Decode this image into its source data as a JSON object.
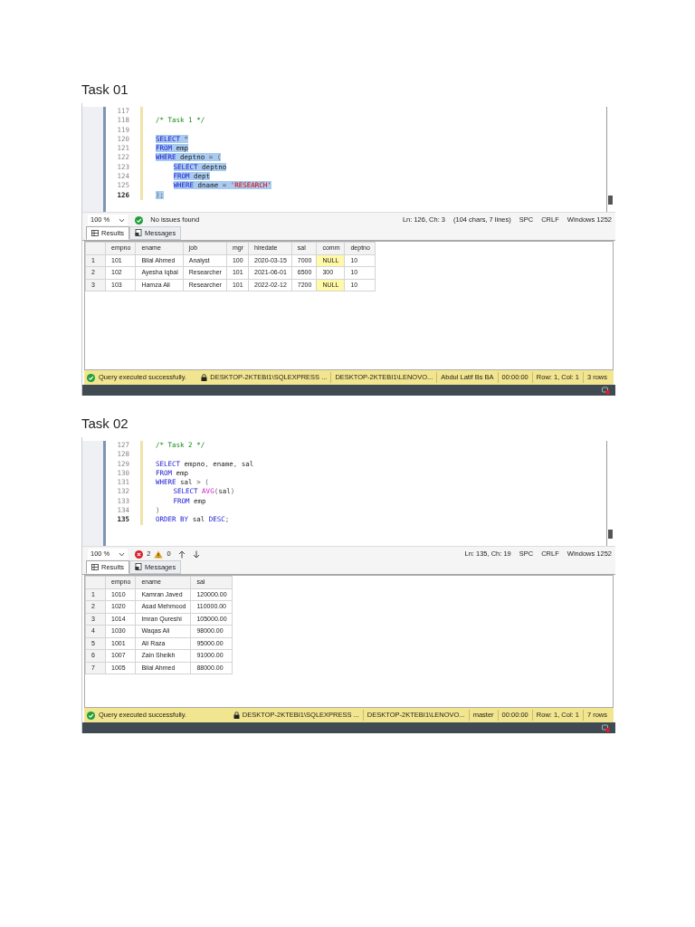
{
  "tasks": [
    {
      "heading": "Task 01",
      "editor": {
        "lines": [
          {
            "number": "117",
            "current": false,
            "selected": false
          },
          {
            "number": "118",
            "current": false,
            "selected": false,
            "indented": false,
            "tokens": [
              {
                "kind": "comment",
                "text": "/* Task 1 */"
              }
            ]
          },
          {
            "number": "119",
            "current": false,
            "selected": false
          },
          {
            "number": "120",
            "current": false,
            "selected": true,
            "indented": false,
            "tokens": [
              {
                "kind": "keyword",
                "text": "SELECT"
              },
              {
                "kind": "punct",
                "text": " *"
              }
            ]
          },
          {
            "number": "121",
            "current": false,
            "selected": true,
            "indented": false,
            "tokens": [
              {
                "kind": "keyword",
                "text": "FROM"
              },
              {
                "kind": "ident",
                "text": " emp"
              }
            ]
          },
          {
            "number": "122",
            "current": false,
            "selected": true,
            "indented": false,
            "tokens": [
              {
                "kind": "keyword",
                "text": "WHERE"
              },
              {
                "kind": "ident",
                "text": " deptno "
              },
              {
                "kind": "punct",
                "text": "= ("
              }
            ]
          },
          {
            "number": "123",
            "current": false,
            "selected": true,
            "indented": true,
            "tokens": [
              {
                "kind": "keyword",
                "text": "SELECT"
              },
              {
                "kind": "ident",
                "text": " deptno"
              }
            ]
          },
          {
            "number": "124",
            "current": false,
            "selected": true,
            "indented": true,
            "tokens": [
              {
                "kind": "keyword",
                "text": "FROM"
              },
              {
                "kind": "ident",
                "text": " dept"
              }
            ]
          },
          {
            "number": "125",
            "current": false,
            "selected": true,
            "indented": true,
            "tokens": [
              {
                "kind": "keyword",
                "text": "WHERE"
              },
              {
                "kind": "ident",
                "text": " dname "
              },
              {
                "kind": "punct",
                "text": "= "
              },
              {
                "kind": "string",
                "text": "'RESEARCH'"
              }
            ]
          },
          {
            "number": "126",
            "current": true,
            "selected": true,
            "indented": false,
            "tokens": [
              {
                "kind": "punct",
                "text": ");"
              }
            ]
          }
        ]
      },
      "toolbar": {
        "zoom": "100 %",
        "issues": {
          "kind": "none",
          "text": "No issues found"
        },
        "position": [
          "Ln: 126, Ch: 3",
          "(104 chars, 7 lines)",
          "SPC",
          "CRLF",
          "Windows 1252"
        ]
      },
      "result_tabs": [
        {
          "label": "Results",
          "selected": true
        },
        {
          "label": "Messages",
          "selected": false
        }
      ],
      "grid": {
        "columns": [
          "empno",
          "ename",
          "job",
          "mgr",
          "hiredate",
          "sal",
          "comm",
          "deptno"
        ],
        "rows": [
          {
            "number": "1",
            "cells": [
              {
                "text": "101",
                "null": false
              },
              {
                "text": "Bilal Ahmed",
                "null": false
              },
              {
                "text": "Analyst",
                "null": false
              },
              {
                "text": "100",
                "null": false
              },
              {
                "text": "2020-03-15",
                "null": false
              },
              {
                "text": "7000",
                "null": false
              },
              {
                "text": "NULL",
                "null": true
              },
              {
                "text": "10",
                "null": false
              }
            ]
          },
          {
            "number": "2",
            "cells": [
              {
                "text": "102",
                "null": false
              },
              {
                "text": "Ayesha Iqbal",
                "null": false
              },
              {
                "text": "Researcher",
                "null": false
              },
              {
                "text": "101",
                "null": false
              },
              {
                "text": "2021-06-01",
                "null": false
              },
              {
                "text": "6500",
                "null": false
              },
              {
                "text": "300",
                "null": false
              },
              {
                "text": "10",
                "null": false
              }
            ]
          },
          {
            "number": "3",
            "cells": [
              {
                "text": "103",
                "null": false
              },
              {
                "text": "Hamza Ali",
                "null": false
              },
              {
                "text": "Researcher",
                "null": false
              },
              {
                "text": "101",
                "null": false
              },
              {
                "text": "2022-02-12",
                "null": false
              },
              {
                "text": "7200",
                "null": false
              },
              {
                "text": "NULL",
                "null": true
              },
              {
                "text": "10",
                "null": false
              }
            ]
          }
        ]
      },
      "status_bar": {
        "message": "Query executed successfully.",
        "segments": [
          "DESKTOP-2KTEBI1\\SQLEXPRESS ...",
          "DESKTOP-2KTEBI1\\LENOVO...",
          "Abdul Latif Bs BA",
          "00:00:00",
          "Row: 1, Col: 1",
          "3 rows"
        ]
      }
    },
    {
      "heading": "Task 02",
      "editor": {
        "lines": [
          {
            "number": "127",
            "current": false,
            "selected": false,
            "indented": false,
            "tokens": [
              {
                "kind": "comment",
                "text": "/* Task 2 */"
              }
            ]
          },
          {
            "number": "128",
            "current": false,
            "selected": false
          },
          {
            "number": "129",
            "current": false,
            "selected": false,
            "indented": false,
            "tokens": [
              {
                "kind": "keyword",
                "text": "SELECT"
              },
              {
                "kind": "ident",
                "text": " empno"
              },
              {
                "kind": "punct",
                "text": ", "
              },
              {
                "kind": "ident",
                "text": "ename"
              },
              {
                "kind": "punct",
                "text": ", "
              },
              {
                "kind": "ident",
                "text": "sal"
              }
            ]
          },
          {
            "number": "130",
            "current": false,
            "selected": false,
            "indented": false,
            "tokens": [
              {
                "kind": "keyword",
                "text": "FROM"
              },
              {
                "kind": "ident",
                "text": " emp"
              }
            ]
          },
          {
            "number": "131",
            "current": false,
            "selected": false,
            "indented": false,
            "tokens": [
              {
                "kind": "keyword",
                "text": "WHERE"
              },
              {
                "kind": "ident",
                "text": " sal "
              },
              {
                "kind": "punct",
                "text": "> ("
              }
            ]
          },
          {
            "number": "132",
            "current": false,
            "selected": false,
            "indented": true,
            "tokens": [
              {
                "kind": "keyword",
                "text": "SELECT "
              },
              {
                "kind": "function",
                "text": "AVG"
              },
              {
                "kind": "punct",
                "text": "("
              },
              {
                "kind": "ident",
                "text": "sal"
              },
              {
                "kind": "punct",
                "text": ")"
              }
            ]
          },
          {
            "number": "133",
            "current": false,
            "selected": false,
            "indented": true,
            "tokens": [
              {
                "kind": "keyword",
                "text": "FROM"
              },
              {
                "kind": "ident",
                "text": " emp"
              }
            ]
          },
          {
            "number": "134",
            "current": false,
            "selected": false,
            "indented": false,
            "tokens": [
              {
                "kind": "punct",
                "text": ")"
              }
            ]
          },
          {
            "number": "135",
            "current": true,
            "selected": false,
            "indented": false,
            "tokens": [
              {
                "kind": "keyword",
                "text": "ORDER BY"
              },
              {
                "kind": "ident",
                "text": " sal "
              },
              {
                "kind": "keyword",
                "text": "DESC"
              },
              {
                "kind": "punct",
                "text": ";"
              }
            ]
          }
        ]
      },
      "toolbar": {
        "zoom": "100 %",
        "issues": {
          "kind": "counts",
          "errors": "2",
          "warnings": "0"
        },
        "position": [
          "Ln: 135, Ch: 19",
          "SPC",
          "CRLF",
          "Windows 1252"
        ]
      },
      "result_tabs": [
        {
          "label": "Results",
          "selected": true
        },
        {
          "label": "Messages",
          "selected": false
        }
      ],
      "grid": {
        "columns": [
          "empno",
          "ename",
          "sal"
        ],
        "rows": [
          {
            "number": "1",
            "cells": [
              {
                "text": "1010",
                "null": false
              },
              {
                "text": "Kamran Javed",
                "null": false
              },
              {
                "text": "120000.00",
                "null": false
              }
            ]
          },
          {
            "number": "2",
            "cells": [
              {
                "text": "1020",
                "null": false
              },
              {
                "text": "Asad Mehmood",
                "null": false
              },
              {
                "text": "110000.00",
                "null": false
              }
            ]
          },
          {
            "number": "3",
            "cells": [
              {
                "text": "1014",
                "null": false
              },
              {
                "text": "Imran Qureshi",
                "null": false
              },
              {
                "text": "105000.00",
                "null": false
              }
            ]
          },
          {
            "number": "4",
            "cells": [
              {
                "text": "1030",
                "null": false
              },
              {
                "text": "Waqas Ali",
                "null": false
              },
              {
                "text": "98000.00",
                "null": false
              }
            ]
          },
          {
            "number": "5",
            "cells": [
              {
                "text": "1001",
                "null": false
              },
              {
                "text": "Ali Raza",
                "null": false
              },
              {
                "text": "95000.00",
                "null": false
              }
            ]
          },
          {
            "number": "6",
            "cells": [
              {
                "text": "1007",
                "null": false
              },
              {
                "text": "Zain Sheikh",
                "null": false
              },
              {
                "text": "91000.00",
                "null": false
              }
            ]
          },
          {
            "number": "7",
            "cells": [
              {
                "text": "1005",
                "null": false
              },
              {
                "text": "Bilal Ahmed",
                "null": false
              },
              {
                "text": "88000.00",
                "null": false
              }
            ]
          }
        ]
      },
      "status_bar": {
        "message": "Query executed successfully.",
        "segments": [
          "DESKTOP-2KTEBI1\\SQLEXPRESS ...",
          "DESKTOP-2KTEBI1\\LENOVO...",
          "master",
          "00:00:00",
          "Row: 1, Col: 1",
          "7 rows"
        ]
      }
    }
  ]
}
